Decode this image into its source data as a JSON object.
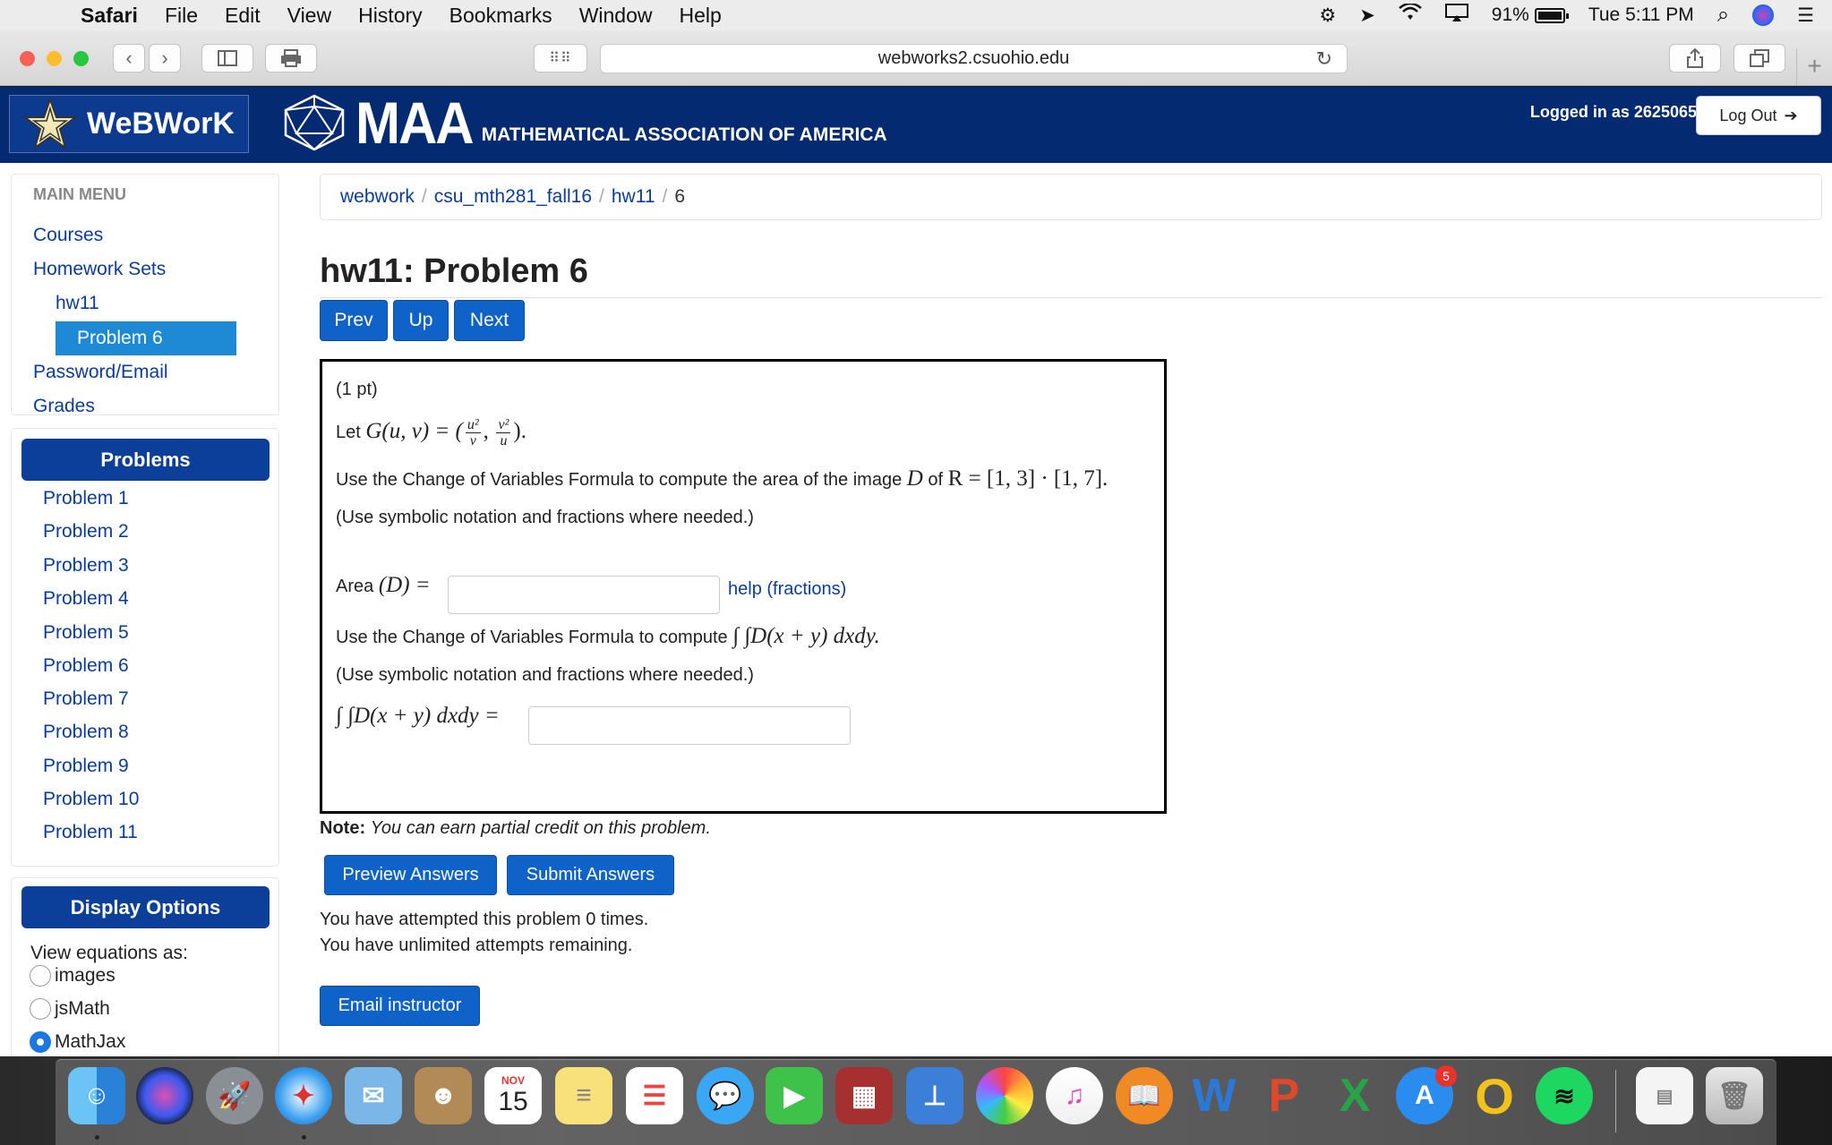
{
  "menubar": {
    "app": "Safari",
    "items": [
      "File",
      "Edit",
      "View",
      "History",
      "Bookmarks",
      "Window",
      "Help"
    ],
    "battery": "91%",
    "clock": "Tue 5:11 PM"
  },
  "browser": {
    "url": "webworks2.csuohio.edu"
  },
  "header": {
    "logo_text": "WeBWorK",
    "maa_big": "MAA",
    "maa_sub": "MATHEMATICAL ASSOCIATION OF AMERICA",
    "logged_in": "Logged in as 2625065.",
    "logout_label": "Log Out"
  },
  "main_menu": {
    "title": "MAIN MENU",
    "courses": "Courses",
    "homework_sets": "Homework Sets",
    "hw": "hw11",
    "current_problem": "Problem 6",
    "password": "Password/Email",
    "grades": "Grades"
  },
  "problems_panel": {
    "title": "Problems",
    "items": [
      "Problem 1",
      "Problem 2",
      "Problem 3",
      "Problem 4",
      "Problem 5",
      "Problem 6",
      "Problem 7",
      "Problem 8",
      "Problem 9",
      "Problem 10",
      "Problem 11"
    ]
  },
  "display_options": {
    "title": "Display Options",
    "label": "View equations as:",
    "options": [
      "images",
      "jsMath",
      "MathJax"
    ],
    "selected": "MathJax"
  },
  "breadcrumb": {
    "items": [
      "webwork",
      "csu_mth281_fall16",
      "hw11"
    ],
    "current": "6"
  },
  "page_title": "hw11: Problem 6",
  "nav": {
    "prev": "Prev",
    "up": "Up",
    "next": "Next"
  },
  "problem": {
    "points": "(1 pt)",
    "let": "Let",
    "func": "G(u, v) = (",
    "frac1_num": "u²",
    "frac1_den": "v",
    "frac2_num": "v²",
    "frac2_den": "u",
    "func_close": ").",
    "q1_text": "Use the Change of Variables Formula to compute the area of the image",
    "q1_D": "D",
    "q1_of": "of",
    "q1_R": "R = [1, 3] · [1, 7].",
    "hint": "(Use symbolic notation and fractions where needed.)",
    "area_label_text": "Area",
    "area_label_math": "(D) =",
    "area_value": "",
    "help_link": "help (fractions)",
    "q2_text": "Use the Change of Variables Formula to compute",
    "q2_math": "∫ ∫D(x + y) dxdy.",
    "integral_label": "∫ ∫D(x + y) dxdy =",
    "integral_value": ""
  },
  "note": {
    "bold": "Note:",
    "text": "You can earn partial credit on this problem."
  },
  "actions": {
    "preview": "Preview Answers",
    "submit": "Submit Answers",
    "email": "Email instructor"
  },
  "attempts": {
    "line1": "You have attempted this problem 0 times.",
    "line2": "You have unlimited attempts remaining."
  },
  "dock": {
    "calendar_month": "NOV",
    "calendar_day": "15",
    "appstore_badge": "5",
    "apps": [
      "finder-icon",
      "siri-icon",
      "launchpad-icon",
      "safari-icon",
      "mail-icon",
      "contacts-icon",
      "calendar-icon",
      "notes-icon",
      "reminders-icon",
      "messages-icon",
      "facetime-icon",
      "photo-booth-icon",
      "keynote-icon",
      "photos-icon",
      "itunes-icon",
      "ibooks-icon",
      "word-icon",
      "powerpoint-icon",
      "excel-icon",
      "app-store-icon",
      "outlook-icon",
      "spotify-icon",
      "document-icon",
      "trash-icon"
    ]
  }
}
